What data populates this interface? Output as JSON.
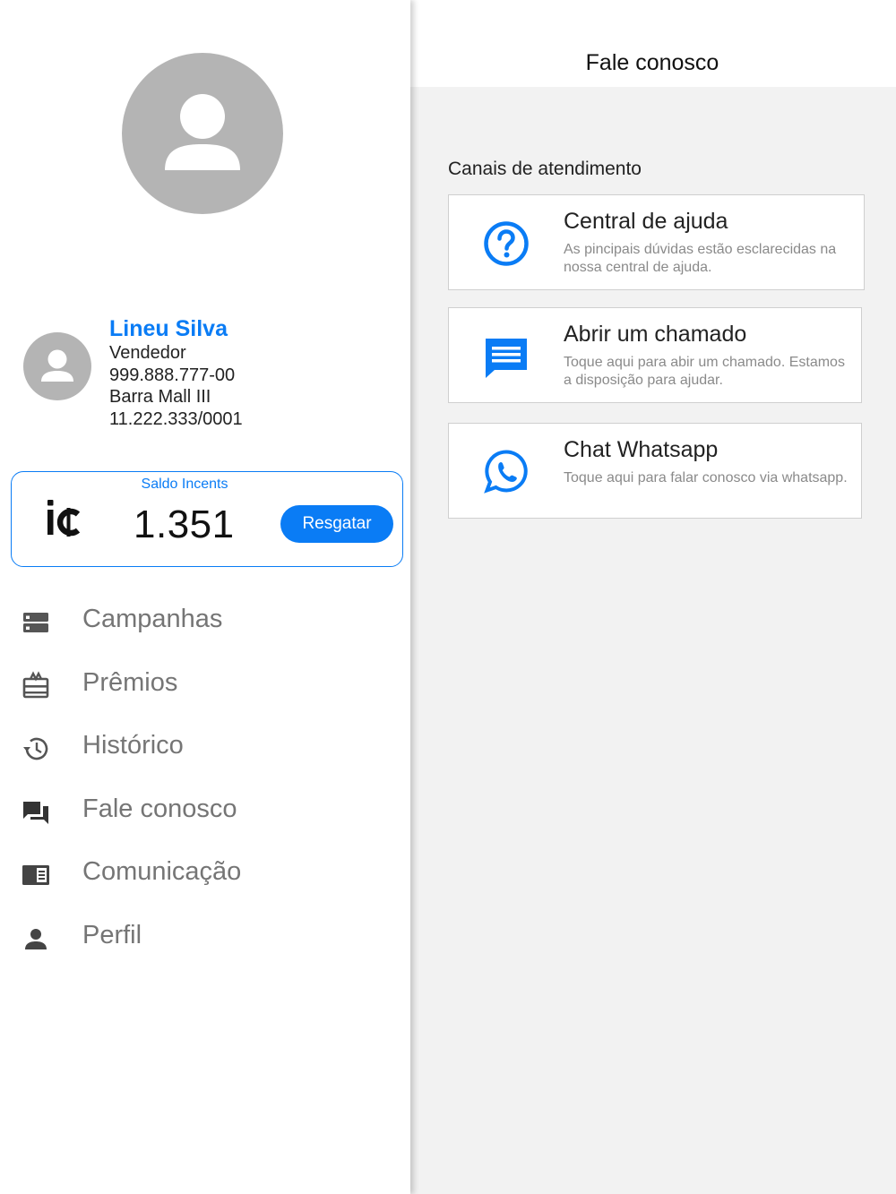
{
  "colors": {
    "accent": "#0a7cf5",
    "avatar_bg": "#b4b4b4",
    "menu_text": "#757575",
    "main_bg": "#f2f2f2"
  },
  "sidebar": {
    "avatar_icon": "person-icon",
    "profile": {
      "name": "Lineu Silva",
      "role": "Vendedor",
      "cpf": "999.888.777-00",
      "store": "Barra Mall III",
      "cnpj": "11.222.333/0001"
    },
    "balance": {
      "label": "Saldo Incents",
      "logo_icon": "incents-logo-icon",
      "value": "1.351",
      "redeem_label": "Resgatar"
    },
    "menu": [
      {
        "label": "Campanhas",
        "icon": "campaigns-icon"
      },
      {
        "label": "Prêmios",
        "icon": "gift-card-icon"
      },
      {
        "label": "Histórico",
        "icon": "history-icon"
      },
      {
        "label": "Fale conosco",
        "icon": "chat-icon"
      },
      {
        "label": "Comunicação",
        "icon": "newspaper-icon"
      },
      {
        "label": "Perfil",
        "icon": "person-icon"
      }
    ]
  },
  "main": {
    "header_title": "Fale conosco",
    "section_title": "Canais de atendimento",
    "channels": [
      {
        "title": "Central de ajuda",
        "description": "As pincipais dúvidas estão esclarecidas na nossa central de ajuda.",
        "icon": "help-circle-icon"
      },
      {
        "title": "Abrir um chamado",
        "description": "Toque aqui para abir um chamado. Estamos a disposição para ajudar.",
        "icon": "message-icon"
      },
      {
        "title": "Chat Whatsapp",
        "description": "Toque aqui para falar conosco via whatsapp.",
        "icon": "whatsapp-icon"
      }
    ]
  }
}
